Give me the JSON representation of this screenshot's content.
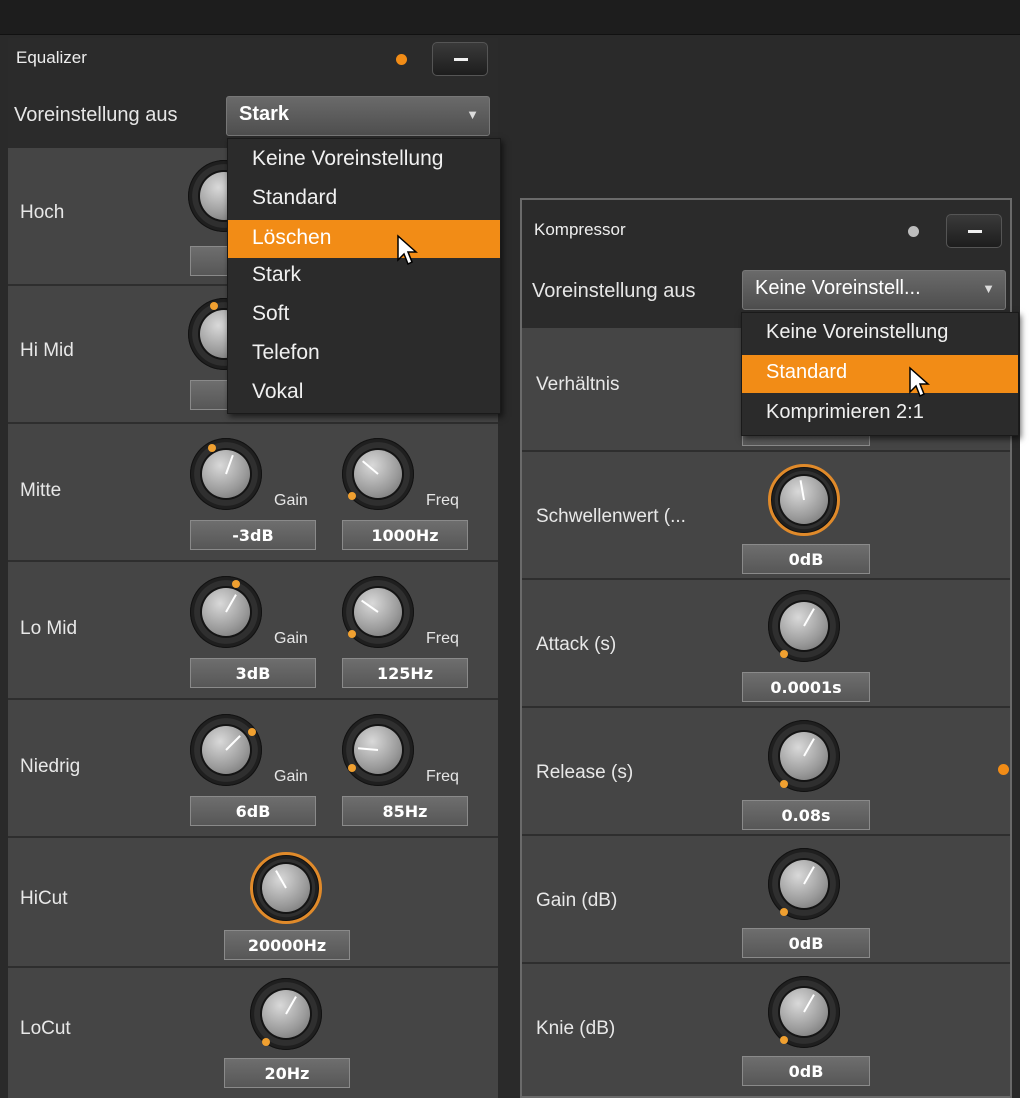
{
  "colors": {
    "accent": "#f28c16",
    "panel": "#454545",
    "header": "#2b2b2b"
  },
  "equalizer": {
    "title": "Equalizer",
    "preset_label": "Voreinstellung aus",
    "preset_value": "Stark",
    "dropdown_items": [
      "Keine Voreinstellung",
      "Standard",
      "Löschen",
      "Stark",
      "Soft",
      "Telefon",
      "Vokal"
    ],
    "highlighted_item": "Löschen",
    "bands": {
      "hoch": {
        "label": "Hoch"
      },
      "himid": {
        "label": "Hi Mid"
      },
      "mitte": {
        "label": "Mitte",
        "gain_label": "Gain",
        "freq_label": "Freq",
        "gain": "-3dB",
        "freq": "1000Hz"
      },
      "lomid": {
        "label": "Lo Mid",
        "gain_label": "Gain",
        "freq_label": "Freq",
        "gain": "3dB",
        "freq": "125Hz"
      },
      "niedrig": {
        "label": "Niedrig",
        "gain_label": "Gain",
        "freq_label": "Freq",
        "gain": "6dB",
        "freq": "85Hz"
      },
      "hicut": {
        "label": "HiCut",
        "value": "20000Hz"
      },
      "locut": {
        "label": "LoCut",
        "value": "20Hz"
      }
    }
  },
  "kompressor": {
    "title": "Kompressor",
    "preset_label": "Voreinstellung aus",
    "preset_value": "Keine Voreinstell...",
    "dropdown_items": [
      "Keine Voreinstellung",
      "Standard",
      "Komprimieren 2:1"
    ],
    "highlighted_item": "Standard",
    "rows": {
      "ratio": {
        "label": "Verhältnis"
      },
      "threshold": {
        "label": "Schwellenwert (...",
        "value": "0dB"
      },
      "attack": {
        "label": "Attack (s)",
        "value": "0.0001s"
      },
      "release": {
        "label": "Release (s)",
        "value": "0.08s"
      },
      "gain": {
        "label": "Gain (dB)",
        "value": "0dB"
      },
      "knee": {
        "label": "Knie (dB)",
        "value": "0dB"
      }
    }
  },
  "icons": {
    "minimize": "minimize-icon",
    "arrow": "dropdown-arrow-icon",
    "cursor": "mouse-pointer-icon"
  }
}
